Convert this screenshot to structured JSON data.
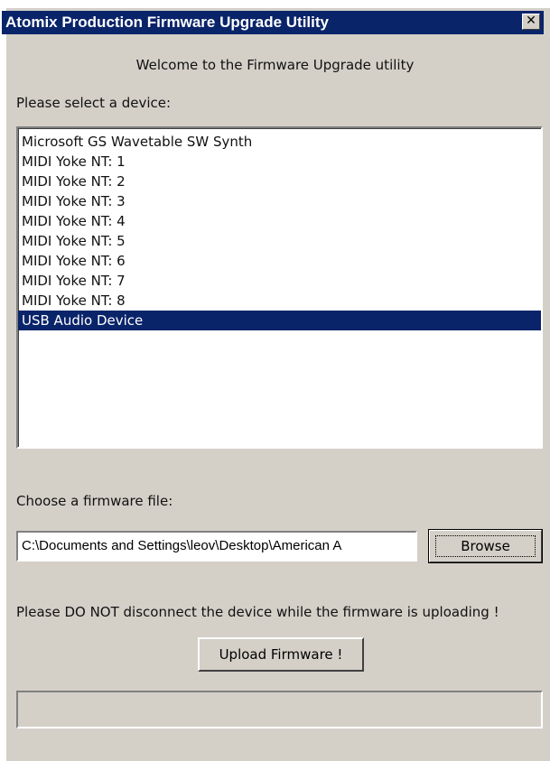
{
  "window": {
    "title": "Atomix Production Firmware Upgrade Utility",
    "close_glyph": "✕"
  },
  "welcome_text": "Welcome to the Firmware Upgrade utility",
  "device_section": {
    "label": "Please select a device:",
    "devices": [
      "Microsoft GS Wavetable SW Synth",
      "MIDI Yoke NT:  1",
      "MIDI Yoke NT:  2",
      "MIDI Yoke NT:  3",
      "MIDI Yoke NT:  4",
      "MIDI Yoke NT:  5",
      "MIDI Yoke NT:  6",
      "MIDI Yoke NT:  7",
      "MIDI Yoke NT:  8",
      "USB Audio Device"
    ],
    "selected_index": 9
  },
  "firmware_section": {
    "label": "Choose a firmware file:",
    "file_path": "C:\\Documents and Settings\\leov\\Desktop\\American A",
    "browse_label": "Browse"
  },
  "warning_text": "Please DO NOT disconnect the device while the firmware is uploading !",
  "upload_label": "Upload Firmware !",
  "progress": {
    "value": 0
  },
  "colors": {
    "titlebar": "#0a246a",
    "selection": "#0a246a",
    "window_bg": "#d4d0c8"
  }
}
